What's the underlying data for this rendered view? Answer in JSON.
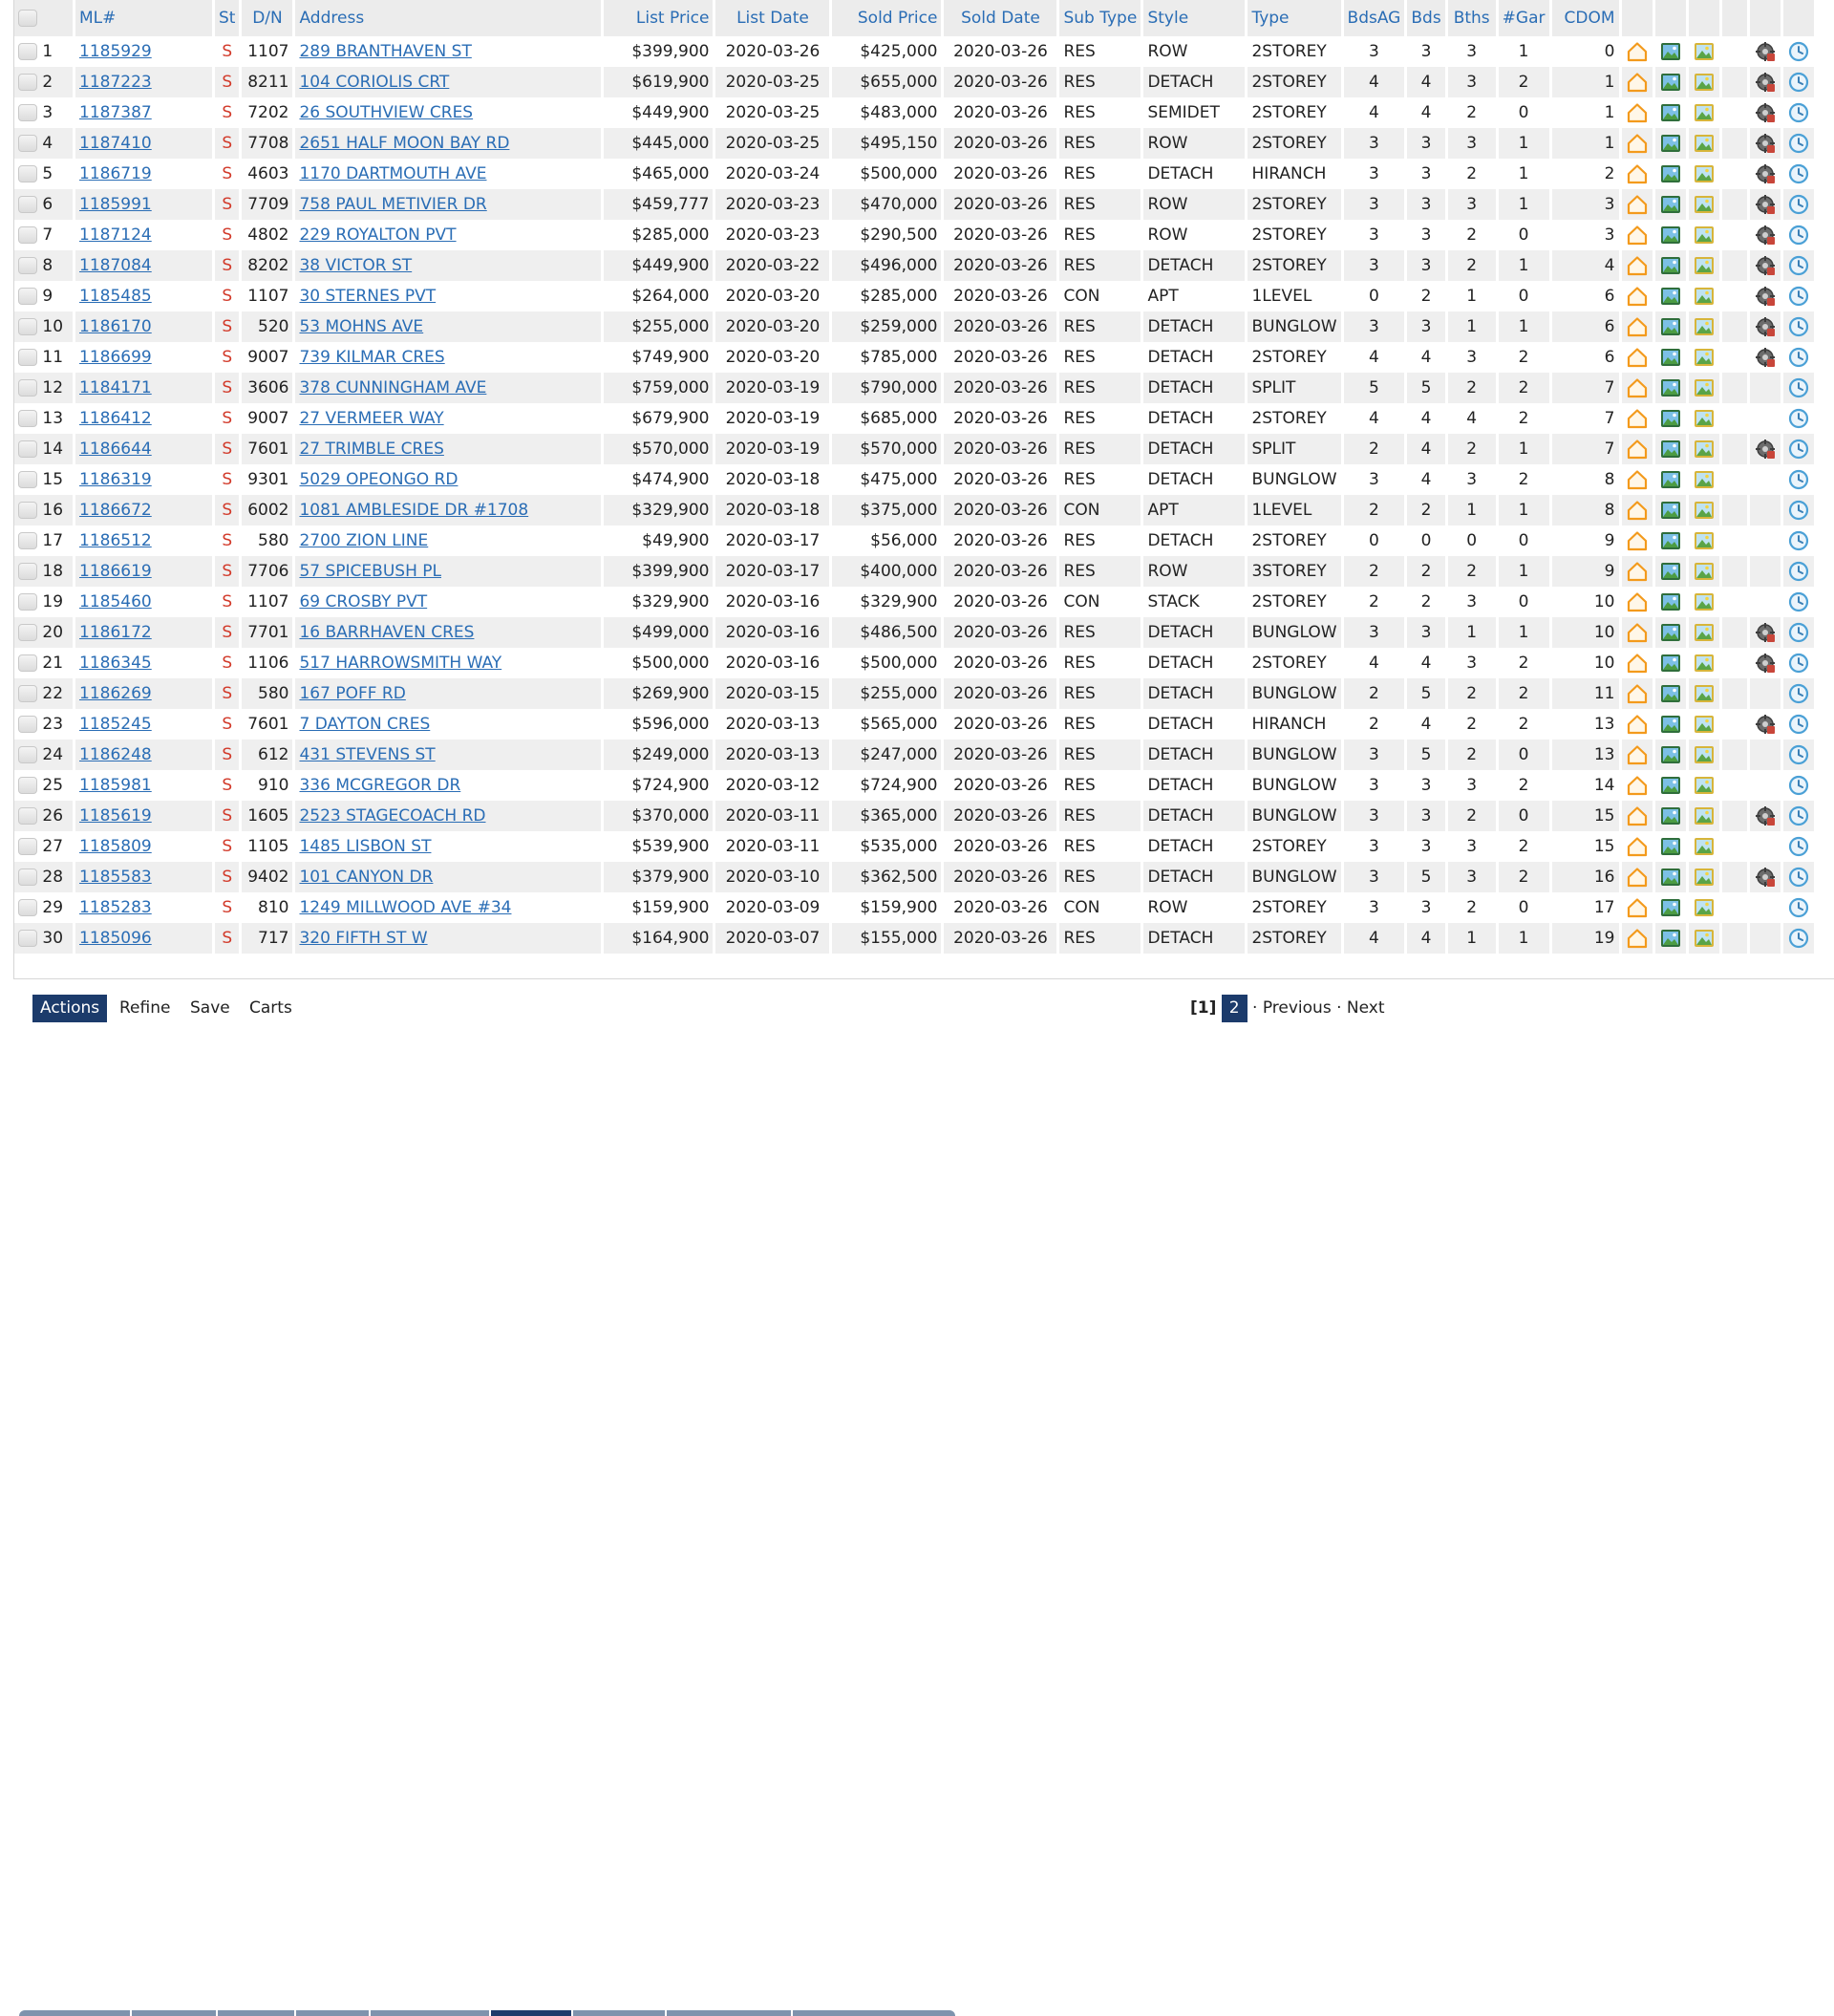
{
  "columns": {
    "ml": "ML#",
    "st": "St",
    "dn": "D/N",
    "address": "Address",
    "list_price": "List Price",
    "list_date": "List Date",
    "sold_price": "Sold Price",
    "sold_date": "Sold Date",
    "sub_type": "Sub Type",
    "style": "Style",
    "type": "Type",
    "bdsag": "BdsAG",
    "bds": "Bds",
    "bths": "Bths",
    "gar": "#Gar",
    "cdom": "CDOM"
  },
  "rows": [
    {
      "n": "1",
      "ml": "1185929",
      "st": "S",
      "dn": "1107",
      "address": "289 BRANTHAVEN ST",
      "list_price": "$399,900",
      "list_date": "2020-03-26",
      "sold_price": "$425,000",
      "sold_date": "2020-03-26",
      "sub_type": "RES",
      "style": "ROW",
      "type": "2STOREY",
      "bdsag": "3",
      "bds": "3",
      "bths": "3",
      "gar": "1",
      "cdom": "0",
      "has_extra": true
    },
    {
      "n": "2",
      "ml": "1187223",
      "st": "S",
      "dn": "8211",
      "address": "104 CORIOLIS CRT",
      "list_price": "$619,900",
      "list_date": "2020-03-25",
      "sold_price": "$655,000",
      "sold_date": "2020-03-26",
      "sub_type": "RES",
      "style": "DETACH",
      "type": "2STOREY",
      "bdsag": "4",
      "bds": "4",
      "bths": "3",
      "gar": "2",
      "cdom": "1",
      "has_extra": true
    },
    {
      "n": "3",
      "ml": "1187387",
      "st": "S",
      "dn": "7202",
      "address": "26 SOUTHVIEW CRES",
      "list_price": "$449,900",
      "list_date": "2020-03-25",
      "sold_price": "$483,000",
      "sold_date": "2020-03-26",
      "sub_type": "RES",
      "style": "SEMIDET",
      "type": "2STOREY",
      "bdsag": "4",
      "bds": "4",
      "bths": "2",
      "gar": "0",
      "cdom": "1",
      "has_extra": true
    },
    {
      "n": "4",
      "ml": "1187410",
      "st": "S",
      "dn": "7708",
      "address": "2651 HALF MOON BAY RD",
      "list_price": "$445,000",
      "list_date": "2020-03-25",
      "sold_price": "$495,150",
      "sold_date": "2020-03-26",
      "sub_type": "RES",
      "style": "ROW",
      "type": "2STOREY",
      "bdsag": "3",
      "bds": "3",
      "bths": "3",
      "gar": "1",
      "cdom": "1",
      "has_extra": true
    },
    {
      "n": "5",
      "ml": "1186719",
      "st": "S",
      "dn": "4603",
      "address": "1170 DARTMOUTH AVE",
      "list_price": "$465,000",
      "list_date": "2020-03-24",
      "sold_price": "$500,000",
      "sold_date": "2020-03-26",
      "sub_type": "RES",
      "style": "DETACH",
      "type": "HIRANCH",
      "bdsag": "3",
      "bds": "3",
      "bths": "2",
      "gar": "1",
      "cdom": "2",
      "has_extra": true
    },
    {
      "n": "6",
      "ml": "1185991",
      "st": "S",
      "dn": "7709",
      "address": "758 PAUL METIVIER DR",
      "list_price": "$459,777",
      "list_date": "2020-03-23",
      "sold_price": "$470,000",
      "sold_date": "2020-03-26",
      "sub_type": "RES",
      "style": "ROW",
      "type": "2STOREY",
      "bdsag": "3",
      "bds": "3",
      "bths": "3",
      "gar": "1",
      "cdom": "3",
      "has_extra": true
    },
    {
      "n": "7",
      "ml": "1187124",
      "st": "S",
      "dn": "4802",
      "address": "229 ROYALTON PVT",
      "list_price": "$285,000",
      "list_date": "2020-03-23",
      "sold_price": "$290,500",
      "sold_date": "2020-03-26",
      "sub_type": "RES",
      "style": "ROW",
      "type": "2STOREY",
      "bdsag": "3",
      "bds": "3",
      "bths": "2",
      "gar": "0",
      "cdom": "3",
      "has_extra": true
    },
    {
      "n": "8",
      "ml": "1187084",
      "st": "S",
      "dn": "8202",
      "address": "38 VICTOR ST",
      "list_price": "$449,900",
      "list_date": "2020-03-22",
      "sold_price": "$496,000",
      "sold_date": "2020-03-26",
      "sub_type": "RES",
      "style": "DETACH",
      "type": "2STOREY",
      "bdsag": "3",
      "bds": "3",
      "bths": "2",
      "gar": "1",
      "cdom": "4",
      "has_extra": true
    },
    {
      "n": "9",
      "ml": "1185485",
      "st": "S",
      "dn": "1107",
      "address": "30 STERNES PVT",
      "list_price": "$264,000",
      "list_date": "2020-03-20",
      "sold_price": "$285,000",
      "sold_date": "2020-03-26",
      "sub_type": "CON",
      "style": "APT",
      "type": "1LEVEL",
      "bdsag": "0",
      "bds": "2",
      "bths": "1",
      "gar": "0",
      "cdom": "6",
      "has_extra": true
    },
    {
      "n": "10",
      "ml": "1186170",
      "st": "S",
      "dn": "520",
      "address": "53 MOHNS AVE",
      "list_price": "$255,000",
      "list_date": "2020-03-20",
      "sold_price": "$259,000",
      "sold_date": "2020-03-26",
      "sub_type": "RES",
      "style": "DETACH",
      "type": "BUNGLOW",
      "bdsag": "3",
      "bds": "3",
      "bths": "1",
      "gar": "1",
      "cdom": "6",
      "has_extra": true
    },
    {
      "n": "11",
      "ml": "1186699",
      "st": "S",
      "dn": "9007",
      "address": "739 KILMAR CRES",
      "list_price": "$749,900",
      "list_date": "2020-03-20",
      "sold_price": "$785,000",
      "sold_date": "2020-03-26",
      "sub_type": "RES",
      "style": "DETACH",
      "type": "2STOREY",
      "bdsag": "4",
      "bds": "4",
      "bths": "3",
      "gar": "2",
      "cdom": "6",
      "has_extra": true
    },
    {
      "n": "12",
      "ml": "1184171",
      "st": "S",
      "dn": "3606",
      "address": "378 CUNNINGHAM AVE",
      "list_price": "$759,000",
      "list_date": "2020-03-19",
      "sold_price": "$790,000",
      "sold_date": "2020-03-26",
      "sub_type": "RES",
      "style": "DETACH",
      "type": "SPLIT",
      "bdsag": "5",
      "bds": "5",
      "bths": "2",
      "gar": "2",
      "cdom": "7",
      "has_extra": false
    },
    {
      "n": "13",
      "ml": "1186412",
      "st": "S",
      "dn": "9007",
      "address": "27 VERMEER WAY",
      "list_price": "$679,900",
      "list_date": "2020-03-19",
      "sold_price": "$685,000",
      "sold_date": "2020-03-26",
      "sub_type": "RES",
      "style": "DETACH",
      "type": "2STOREY",
      "bdsag": "4",
      "bds": "4",
      "bths": "4",
      "gar": "2",
      "cdom": "7",
      "has_extra": false
    },
    {
      "n": "14",
      "ml": "1186644",
      "st": "S",
      "dn": "7601",
      "address": "27 TRIMBLE CRES",
      "list_price": "$570,000",
      "list_date": "2020-03-19",
      "sold_price": "$570,000",
      "sold_date": "2020-03-26",
      "sub_type": "RES",
      "style": "DETACH",
      "type": "SPLIT",
      "bdsag": "2",
      "bds": "4",
      "bths": "2",
      "gar": "1",
      "cdom": "7",
      "has_extra": true
    },
    {
      "n": "15",
      "ml": "1186319",
      "st": "S",
      "dn": "9301",
      "address": "5029 OPEONGO RD",
      "list_price": "$474,900",
      "list_date": "2020-03-18",
      "sold_price": "$475,000",
      "sold_date": "2020-03-26",
      "sub_type": "RES",
      "style": "DETACH",
      "type": "BUNGLOW",
      "bdsag": "3",
      "bds": "4",
      "bths": "3",
      "gar": "2",
      "cdom": "8",
      "has_extra": false
    },
    {
      "n": "16",
      "ml": "1186672",
      "st": "S",
      "dn": "6002",
      "address": "1081 AMBLESIDE DR #1708",
      "list_price": "$329,900",
      "list_date": "2020-03-18",
      "sold_price": "$375,000",
      "sold_date": "2020-03-26",
      "sub_type": "CON",
      "style": "APT",
      "type": "1LEVEL",
      "bdsag": "2",
      "bds": "2",
      "bths": "1",
      "gar": "1",
      "cdom": "8",
      "has_extra": false
    },
    {
      "n": "17",
      "ml": "1186512",
      "st": "S",
      "dn": "580",
      "address": "2700 ZION LINE",
      "list_price": "$49,900",
      "list_date": "2020-03-17",
      "sold_price": "$56,000",
      "sold_date": "2020-03-26",
      "sub_type": "RES",
      "style": "DETACH",
      "type": "2STOREY",
      "bdsag": "0",
      "bds": "0",
      "bths": "0",
      "gar": "0",
      "cdom": "9",
      "has_extra": false
    },
    {
      "n": "18",
      "ml": "1186619",
      "st": "S",
      "dn": "7706",
      "address": "57 SPICEBUSH PL",
      "list_price": "$399,900",
      "list_date": "2020-03-17",
      "sold_price": "$400,000",
      "sold_date": "2020-03-26",
      "sub_type": "RES",
      "style": "ROW",
      "type": "3STOREY",
      "bdsag": "2",
      "bds": "2",
      "bths": "2",
      "gar": "1",
      "cdom": "9",
      "has_extra": false
    },
    {
      "n": "19",
      "ml": "1185460",
      "st": "S",
      "dn": "1107",
      "address": "69 CROSBY PVT",
      "list_price": "$329,900",
      "list_date": "2020-03-16",
      "sold_price": "$329,900",
      "sold_date": "2020-03-26",
      "sub_type": "CON",
      "style": "STACK",
      "type": "2STOREY",
      "bdsag": "2",
      "bds": "2",
      "bths": "3",
      "gar": "0",
      "cdom": "10",
      "has_extra": false
    },
    {
      "n": "20",
      "ml": "1186172",
      "st": "S",
      "dn": "7701",
      "address": "16 BARRHAVEN CRES",
      "list_price": "$499,000",
      "list_date": "2020-03-16",
      "sold_price": "$486,500",
      "sold_date": "2020-03-26",
      "sub_type": "RES",
      "style": "DETACH",
      "type": "BUNGLOW",
      "bdsag": "3",
      "bds": "3",
      "bths": "1",
      "gar": "1",
      "cdom": "10",
      "has_extra": true
    },
    {
      "n": "21",
      "ml": "1186345",
      "st": "S",
      "dn": "1106",
      "address": "517 HARROWSMITH WAY",
      "list_price": "$500,000",
      "list_date": "2020-03-16",
      "sold_price": "$500,000",
      "sold_date": "2020-03-26",
      "sub_type": "RES",
      "style": "DETACH",
      "type": "2STOREY",
      "bdsag": "4",
      "bds": "4",
      "bths": "3",
      "gar": "2",
      "cdom": "10",
      "has_extra": true
    },
    {
      "n": "22",
      "ml": "1186269",
      "st": "S",
      "dn": "580",
      "address": "167 POFF RD",
      "list_price": "$269,900",
      "list_date": "2020-03-15",
      "sold_price": "$255,000",
      "sold_date": "2020-03-26",
      "sub_type": "RES",
      "style": "DETACH",
      "type": "BUNGLOW",
      "bdsag": "2",
      "bds": "5",
      "bths": "2",
      "gar": "2",
      "cdom": "11",
      "has_extra": false
    },
    {
      "n": "23",
      "ml": "1185245",
      "st": "S",
      "dn": "7601",
      "address": "7 DAYTON CRES",
      "list_price": "$596,000",
      "list_date": "2020-03-13",
      "sold_price": "$565,000",
      "sold_date": "2020-03-26",
      "sub_type": "RES",
      "style": "DETACH",
      "type": "HIRANCH",
      "bdsag": "2",
      "bds": "4",
      "bths": "2",
      "gar": "2",
      "cdom": "13",
      "has_extra": true
    },
    {
      "n": "24",
      "ml": "1186248",
      "st": "S",
      "dn": "612",
      "address": "431 STEVENS ST",
      "list_price": "$249,000",
      "list_date": "2020-03-13",
      "sold_price": "$247,000",
      "sold_date": "2020-03-26",
      "sub_type": "RES",
      "style": "DETACH",
      "type": "BUNGLOW",
      "bdsag": "3",
      "bds": "5",
      "bths": "2",
      "gar": "0",
      "cdom": "13",
      "has_extra": false
    },
    {
      "n": "25",
      "ml": "1185981",
      "st": "S",
      "dn": "910",
      "address": "336 MCGREGOR DR",
      "list_price": "$724,900",
      "list_date": "2020-03-12",
      "sold_price": "$724,900",
      "sold_date": "2020-03-26",
      "sub_type": "RES",
      "style": "DETACH",
      "type": "BUNGLOW",
      "bdsag": "3",
      "bds": "3",
      "bths": "3",
      "gar": "2",
      "cdom": "14",
      "has_extra": false
    },
    {
      "n": "26",
      "ml": "1185619",
      "st": "S",
      "dn": "1605",
      "address": "2523 STAGECOACH RD",
      "list_price": "$370,000",
      "list_date": "2020-03-11",
      "sold_price": "$365,000",
      "sold_date": "2020-03-26",
      "sub_type": "RES",
      "style": "DETACH",
      "type": "BUNGLOW",
      "bdsag": "3",
      "bds": "3",
      "bths": "2",
      "gar": "0",
      "cdom": "15",
      "has_extra": true
    },
    {
      "n": "27",
      "ml": "1185809",
      "st": "S",
      "dn": "1105",
      "address": "1485 LISBON ST",
      "list_price": "$539,900",
      "list_date": "2020-03-11",
      "sold_price": "$535,000",
      "sold_date": "2020-03-26",
      "sub_type": "RES",
      "style": "DETACH",
      "type": "2STOREY",
      "bdsag": "3",
      "bds": "3",
      "bths": "3",
      "gar": "2",
      "cdom": "15",
      "has_extra": false
    },
    {
      "n": "28",
      "ml": "1185583",
      "st": "S",
      "dn": "9402",
      "address": "101 CANYON DR",
      "list_price": "$379,900",
      "list_date": "2020-03-10",
      "sold_price": "$362,500",
      "sold_date": "2020-03-26",
      "sub_type": "RES",
      "style": "DETACH",
      "type": "BUNGLOW",
      "bdsag": "3",
      "bds": "5",
      "bths": "3",
      "gar": "2",
      "cdom": "16",
      "has_extra": true
    },
    {
      "n": "29",
      "ml": "1185283",
      "st": "S",
      "dn": "810",
      "address": "1249 MILLWOOD AVE #34",
      "list_price": "$159,900",
      "list_date": "2020-03-09",
      "sold_price": "$159,900",
      "sold_date": "2020-03-26",
      "sub_type": "CON",
      "style": "ROW",
      "type": "2STOREY",
      "bdsag": "3",
      "bds": "3",
      "bths": "2",
      "gar": "0",
      "cdom": "17",
      "has_extra": false
    },
    {
      "n": "30",
      "ml": "1185096",
      "st": "S",
      "dn": "717",
      "address": "320 FIFTH ST W",
      "list_price": "$164,900",
      "list_date": "2020-03-07",
      "sold_price": "$155,000",
      "sold_date": "2020-03-26",
      "sub_type": "RES",
      "style": "DETACH",
      "type": "2STOREY",
      "bdsag": "4",
      "bds": "4",
      "bths": "1",
      "gar": "1",
      "cdom": "19",
      "has_extra": false
    }
  ],
  "row_icons": [
    "house-outline-icon",
    "map-icon",
    "photo-icon",
    "extra-tools-icon",
    "history-clock-icon"
  ],
  "actions": {
    "actions": "Actions",
    "refine": "Refine",
    "save": "Save",
    "carts": "Carts"
  },
  "pager": {
    "current": "[1]",
    "page2": "2",
    "sep": "·",
    "previous": "Previous",
    "next": "Next"
  },
  "colors": {
    "header_text": "#2a6db5",
    "status": "#d23a2a",
    "link": "#2a6db5",
    "active_button": "#1c3b6b"
  }
}
